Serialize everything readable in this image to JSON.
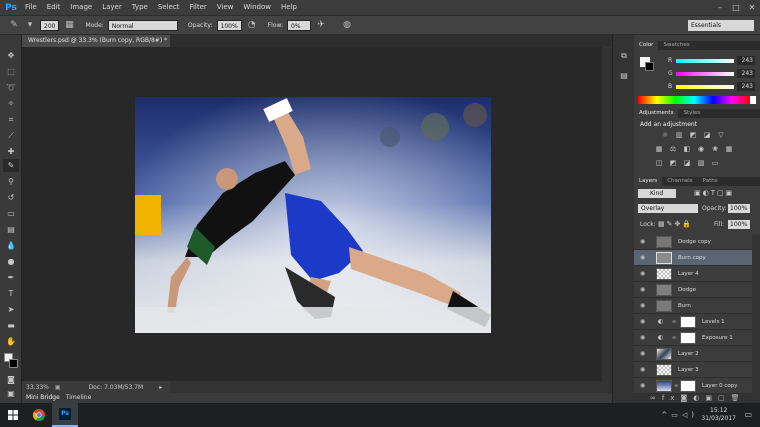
{
  "app": {
    "logo": "Ps",
    "menus": [
      "File",
      "Edit",
      "Image",
      "Layer",
      "Type",
      "Select",
      "Filter",
      "View",
      "Window",
      "Help"
    ]
  },
  "window_controls": [
    "–",
    "□",
    "✕"
  ],
  "options": {
    "brush_size": "200",
    "mode_label": "Mode:",
    "mode_value": "Normal",
    "opacity_label": "Opacity:",
    "opacity_value": "100%",
    "flow_label": "Flow:",
    "flow_value": "0%",
    "workspace": "Essentials"
  },
  "document": {
    "tab_title": "Wrestlers.psd @ 33.3% (Burn copy, RGB/8#) *"
  },
  "status": {
    "zoom": "33.33%",
    "doc": "Doc: 7.03M/53.7M"
  },
  "bottom_tabs": [
    "Mini Bridge",
    "Timeline"
  ],
  "color_panel": {
    "tabs": [
      "Color",
      "Swatches"
    ],
    "channels": [
      {
        "label": "R",
        "value": "243"
      },
      {
        "label": "G",
        "value": "243"
      },
      {
        "label": "B",
        "value": "243"
      }
    ]
  },
  "adjustments_panel": {
    "tabs": [
      "Adjustments",
      "Styles"
    ],
    "heading": "Add an adjustment"
  },
  "layers_panel": {
    "tabs": [
      "Layers",
      "Channels",
      "Paths"
    ],
    "filter": "Kind",
    "blend_mode": "Overlay",
    "opacity_label": "Opacity:",
    "opacity_value": "100%",
    "lock_label": "Lock:",
    "fill_label": "Fill:",
    "fill_value": "100%",
    "layers": [
      {
        "name": "Dodge copy"
      },
      {
        "name": "Burn copy",
        "selected": true
      },
      {
        "name": "Layer 4"
      },
      {
        "name": "Dodge"
      },
      {
        "name": "Burn"
      },
      {
        "name": "Levels 1"
      },
      {
        "name": "Exposure 1"
      },
      {
        "name": "Layer 2"
      },
      {
        "name": "Layer 3"
      },
      {
        "name": "Layer 0 copy"
      }
    ]
  },
  "taskbar": {
    "time": "15:12",
    "date": "31/03/2017"
  },
  "colors": {
    "accent": "#31a8ff",
    "selected_layer": "#5a6573",
    "singlet_blue": "#1c39c8"
  }
}
